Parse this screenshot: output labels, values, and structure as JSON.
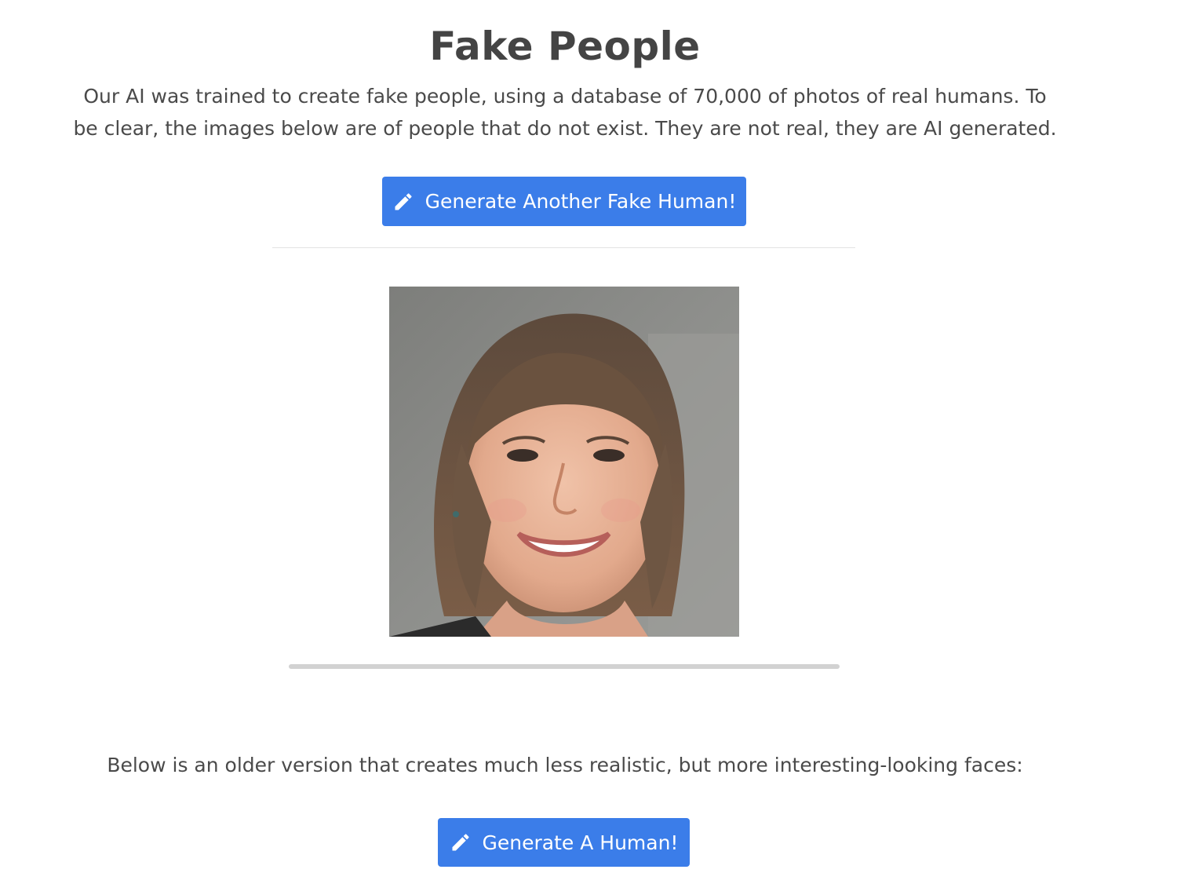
{
  "header": {
    "title": "Fake People"
  },
  "intro": {
    "text": "Our AI was trained to create fake people, using a database of 70,000 of photos of real humans. To be clear, the images below are of people that do not exist. They are not real, they are AI generated."
  },
  "generate_fake_button": {
    "label": "Generate Another Fake Human!",
    "icon": "pencil-icon"
  },
  "generated_face": {
    "description_icon": "generated-face-image"
  },
  "progress": {
    "value": 1.0
  },
  "older_version": {
    "text": "Below is an older version that creates much less realistic, but more interesting-looking faces:"
  },
  "generate_human_button": {
    "label": "Generate A Human!",
    "icon": "pencil-icon"
  },
  "colors": {
    "button_bg": "#3b7de9",
    "text": "#444444"
  }
}
